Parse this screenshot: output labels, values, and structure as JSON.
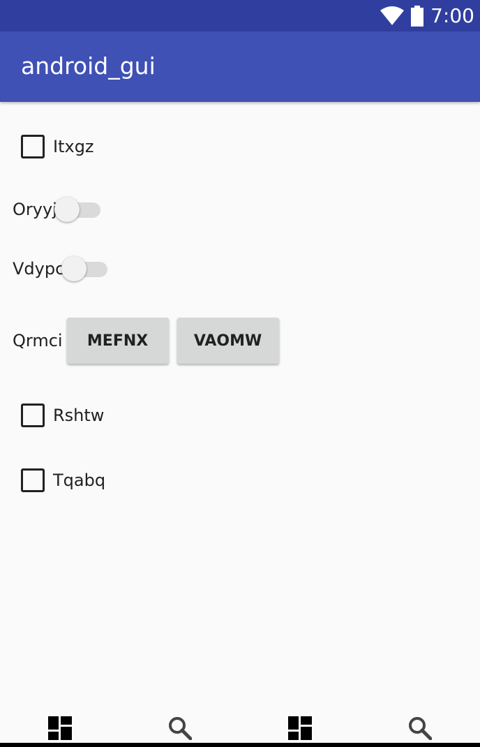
{
  "status_bar": {
    "time": "7:00"
  },
  "app_bar": {
    "title": "android_gui"
  },
  "checkboxes": [
    {
      "label": "Itxgz",
      "checked": false
    },
    {
      "label": "Rshtw",
      "checked": false
    },
    {
      "label": "Tqabq",
      "checked": false
    }
  ],
  "switches": [
    {
      "label": "Oryyj",
      "on": false
    },
    {
      "label": "Vdypc",
      "on": false
    }
  ],
  "button_row": {
    "label": "Qrmci",
    "buttons": [
      "MEFNX",
      "VAOMW"
    ]
  },
  "bottom_nav": {
    "icons": [
      "dashboard-icon",
      "search-icon",
      "dashboard-icon",
      "search-icon"
    ]
  },
  "colors": {
    "status_bar": "#303f9f",
    "app_bar": "#3f51b5",
    "background": "#fafafa",
    "button": "#d6d7d7"
  }
}
